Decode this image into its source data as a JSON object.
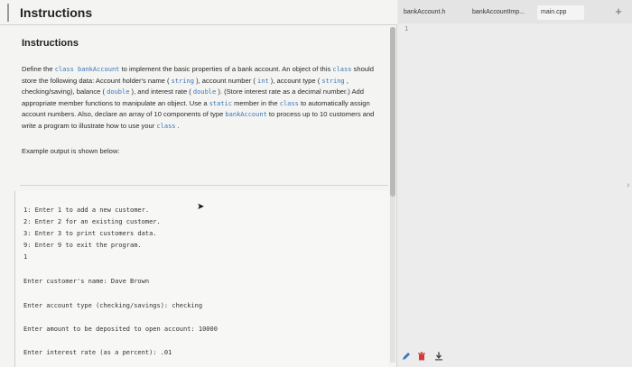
{
  "header": {
    "title": "Instructions"
  },
  "instructions": {
    "section_title": "Instructions",
    "paragraph": [
      {
        "t": "Define the "
      },
      {
        "k": "class bankAccount"
      },
      {
        "t": " to implement the basic properties of a bank account. An object of this "
      },
      {
        "k": "class"
      },
      {
        "t": " should store the following data: Account holder's name ( "
      },
      {
        "k": "string"
      },
      {
        "t": " ), account number ( "
      },
      {
        "k": "int"
      },
      {
        "t": " ), account type ( "
      },
      {
        "k": "string"
      },
      {
        "t": " , checking/saving), balance ( "
      },
      {
        "k": "double"
      },
      {
        "t": " ), and interest rate ( "
      },
      {
        "k": "double"
      },
      {
        "t": " ). (Store interest rate as a decimal number.) Add appropriate member functions to manipulate an object. Use a "
      },
      {
        "k": "static"
      },
      {
        "t": " member in the "
      },
      {
        "k": "class"
      },
      {
        "t": " to automatically assign account numbers. Also, declare an array of 10 components of type "
      },
      {
        "k": "bankAccount"
      },
      {
        "t": " to process up to 10 customers and write a program to illustrate how to use your "
      },
      {
        "k": "class"
      },
      {
        "t": " ."
      }
    ],
    "example_label": "Example output is shown below:"
  },
  "example_output": {
    "menu": [
      "1: Enter 1 to add a new customer.",
      "2: Enter 2 for an existing customer.",
      "3: Enter 3 to print customers data.",
      "9: Enter 9 to exit the program."
    ],
    "menu_input": "1",
    "prompts": [
      "Enter customer's name: Dave Brown",
      "Enter account type (checking/savings): checking",
      "Enter amount to be deposited to open account: 10000",
      "Enter interest rate (as a percent): .01"
    ]
  },
  "editor": {
    "tabs": [
      "bankAccount.h",
      "bankAccountImp...",
      "main.cpp"
    ],
    "active_tab": "main.cpp",
    "line_number": "1",
    "add_tab_symbol": "+"
  },
  "icons": {
    "pencil": "pencil-icon",
    "trash": "trash-icon",
    "download": "download-icon"
  },
  "colors": {
    "keyword": "#3a76b8",
    "pencil": "#3b78c2",
    "trash": "#d23a3a",
    "download": "#444444"
  }
}
